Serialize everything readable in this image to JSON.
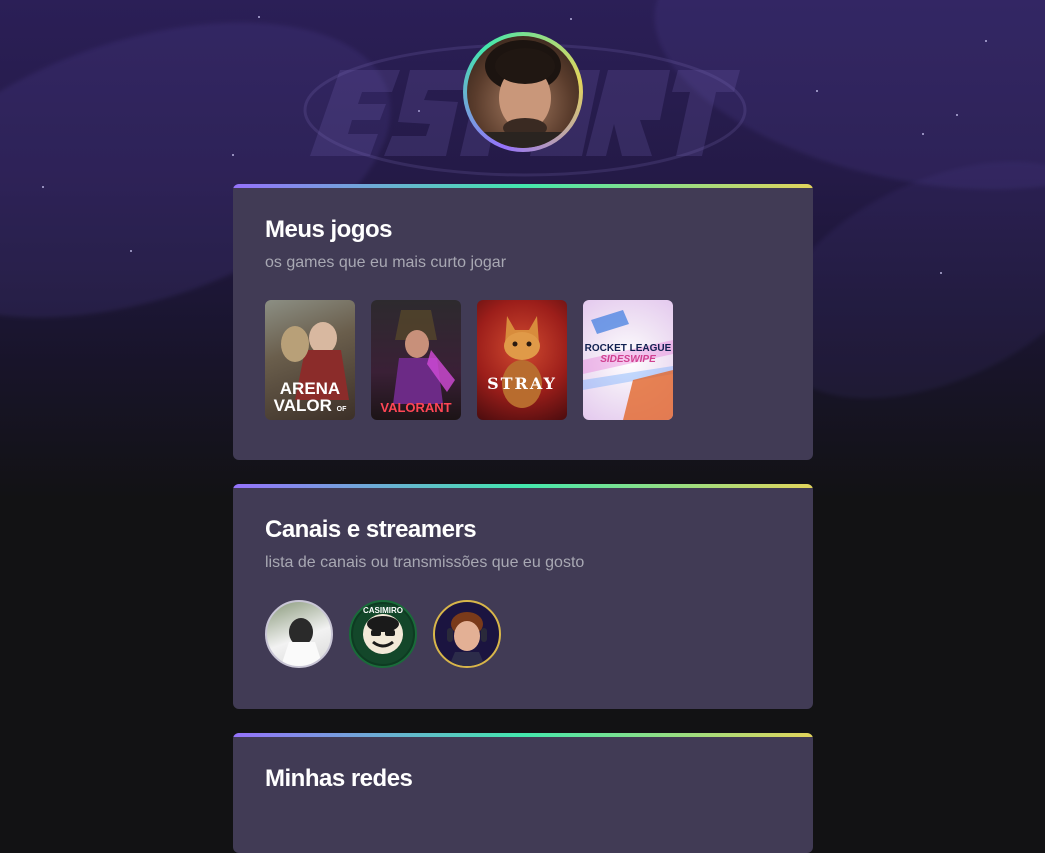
{
  "profile": {
    "avatar_icon": "profile-photo"
  },
  "sections": {
    "games": {
      "title": "Meus jogos",
      "subtitle": "os games que eu mais curto jogar",
      "items": [
        {
          "title": "ARENA VALOR",
          "sub": "OF"
        },
        {
          "title": "VALORANT"
        },
        {
          "title": "STRAY"
        },
        {
          "title": "ROCKET LEAGUE",
          "sub": "SIDESWIPE"
        }
      ]
    },
    "streamers": {
      "title": "Canais e streamers",
      "subtitle": "lista de canais ou transmissões que eu gosto",
      "items": [
        {
          "icon": "streamer-avatar-1"
        },
        {
          "label": "CASIMIRO"
        },
        {
          "icon": "streamer-avatar-3"
        }
      ]
    },
    "social": {
      "title": "Minhas redes"
    }
  },
  "colors": {
    "accent_start": "#9572FC",
    "accent_mid": "#43E7AD",
    "accent_end": "#E2D45C",
    "card_bg": "#413b55"
  }
}
